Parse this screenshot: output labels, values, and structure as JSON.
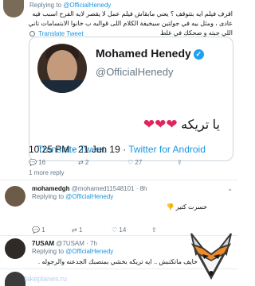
{
  "reply_top": {
    "prefix": "Replying to",
    "handle": "@OfficialHenedy"
  },
  "tweet_text": "اقرف فيلم ايه بتتوقف ؟ يعني مابقاش فيلم عمل لا يقصر لايه الفرح اسبب فيه عادى ، ومثل بيه في جولتين سيخيفة  الكلام اللى قوالبه ب خانوا الابتسامات تاني اللي جبته و ضحكك في غلط",
  "translate_small": "Translate Tweet",
  "embed": {
    "name": "Mohamed Henedy",
    "handle": "@OfficialHenedy",
    "text": "يا تريكه",
    "hearts": "❤❤❤",
    "translate": "Translate Tweet"
  },
  "meta": {
    "time": "10:25 PM · 21 Jun 19 · ",
    "source": "Twitter for Android"
  },
  "actions": {
    "reply_count": "16",
    "retweet_count": "2",
    "like_count": "27"
  },
  "more_reply": "1 more reply",
  "tweet2": {
    "name": "mohamedgh",
    "handle": "@mohamed11548101 · 8h",
    "reply_prefix": "Replying to",
    "reply_handle": "@OfficialHenedy",
    "text": "خسرت كتير 👎"
  },
  "actions2": {
    "reply_count": "1",
    "retweet_count": "1",
    "like_count": "14"
  },
  "tweet3": {
    "name": "7USAM",
    "handle": "@7USAM · 7h",
    "reply_prefix": "Replying to",
    "reply_handle": "@OfficialHenedy",
    "text": "خايف ماتكتبش .. ايه تريكه بخشي بمنصبك الجدعنه والرجوله ."
  },
  "icons": {
    "reply": "reply-icon",
    "retweet": "retweet-icon",
    "like": "heart-icon",
    "share": "share-icon",
    "verified": "verified-badge-icon",
    "globe": "globe-icon",
    "caret": "chevron-down-icon",
    "logo": "fox-logo"
  },
  "colors": {
    "link": "#1b95e0",
    "muted": "#657786",
    "heart": "#e0245e",
    "verified": "#1da1f2"
  },
  "watermark": "fakeplanes.ru"
}
